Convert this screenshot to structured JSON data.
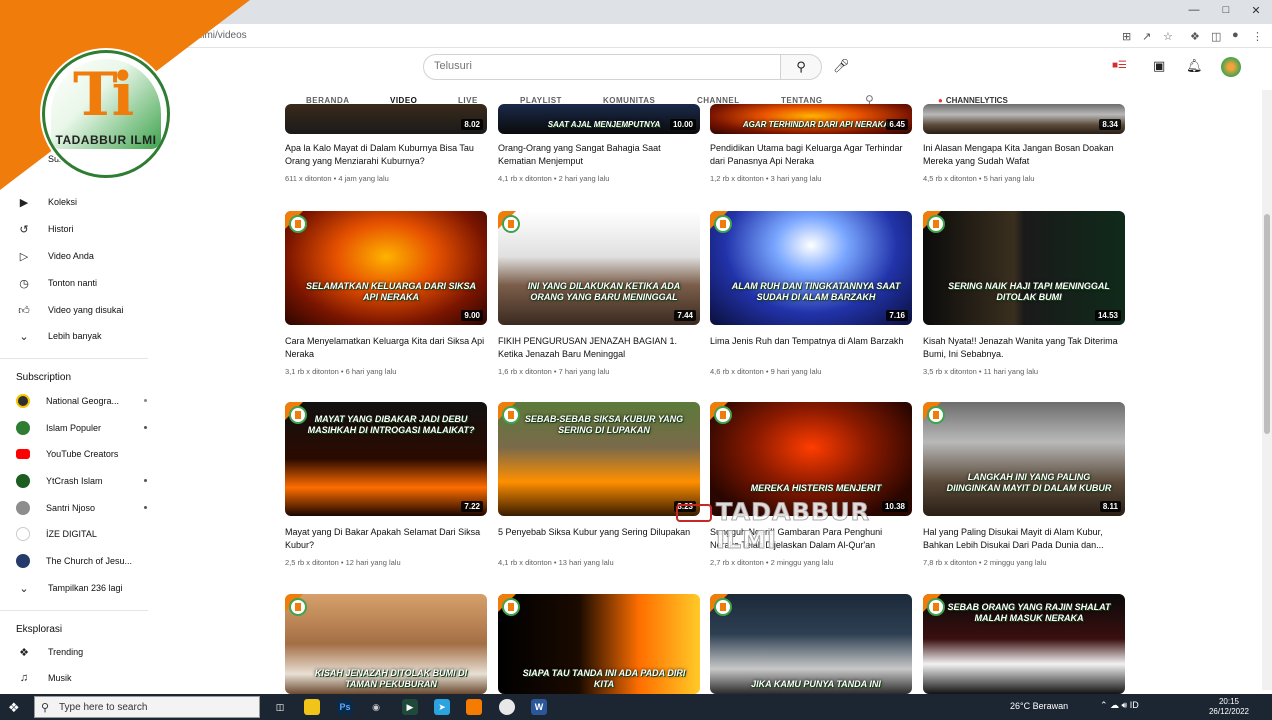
{
  "browser": {
    "url_fragment": "ilmi/videos"
  },
  "channel": {
    "logo_text": "TADABBUR ILMI"
  },
  "header": {
    "search_placeholder": "Telusuri"
  },
  "tabs": [
    {
      "label": "BERANDA"
    },
    {
      "label": "VIDEO"
    },
    {
      "label": "LIVE"
    },
    {
      "label": "PLAYLIST"
    },
    {
      "label": "KOMUNITAS"
    },
    {
      "label": "CHANNEL"
    },
    {
      "label": "TENTANG"
    }
  ],
  "channelytics_label": "CHANNELYTICS",
  "sidebar": {
    "partial_label": "Sub",
    "items": [
      {
        "label": "Koleksi",
        "icon": "library-icon"
      },
      {
        "label": "Histori",
        "icon": "history-icon"
      },
      {
        "label": "Video Anda",
        "icon": "play-icon"
      },
      {
        "label": "Tonton nanti",
        "icon": "clock-icon"
      },
      {
        "label": "Video yang disukai",
        "icon": "thumbs-up-icon"
      },
      {
        "label": "Lebih banyak",
        "icon": "chevron-down-icon"
      }
    ],
    "subscription_heading": "Subscription",
    "subscriptions": [
      {
        "label": "National Geogra...",
        "color": "#2e2e2e"
      },
      {
        "label": "Islam Populer",
        "color": "#2e7d32"
      },
      {
        "label": "YouTube Creators",
        "color": "#ff0000"
      },
      {
        "label": "YtCrash Islam",
        "color": "#1b5e20"
      },
      {
        "label": "Santri Njoso",
        "color": "#8d8d8d"
      },
      {
        "label": "İZE DIGITAL",
        "color": "#ffffff"
      },
      {
        "label": "The Church of Jesu...",
        "color": "#263a6b"
      }
    ],
    "show_more_label": "Tampilkan 236 lagi",
    "explore_heading": "Eksplorasi",
    "explore_items": [
      {
        "label": "Trending",
        "icon": "trending-icon"
      },
      {
        "label": "Musik",
        "icon": "music-icon"
      }
    ]
  },
  "videos": [
    {
      "title": "Apa la Kalo Mayat di Dalam Kuburnya Bisa Tau Orang yang Menziarahi Kuburnya?",
      "views": "611 x ditonton",
      "age": "4 jam yang lalu",
      "duration": "8.02",
      "caption": ""
    },
    {
      "title": "Orang-Orang yang Sangat Bahagia Saat Kematian Menjemput",
      "views": "4,1 rb x ditonton",
      "age": "2 hari yang lalu",
      "duration": "10.00",
      "caption": "SAAT AJAL MENJEMPUTNYA"
    },
    {
      "title": "Pendidikan Utama bagi Keluarga Agar Terhindar dari Panasnya Api Neraka",
      "views": "1,2 rb x ditonton",
      "age": "3 hari yang lalu",
      "duration": "6.45",
      "caption": "AGAR TERHINDAR DARI API NERAKA"
    },
    {
      "title": "Ini Alasan Mengapa Kita Jangan Bosan Doakan Mereka yang Sudah Wafat",
      "views": "4,5 rb x ditonton",
      "age": "5 hari yang lalu",
      "duration": "8.34",
      "caption": ""
    },
    {
      "title": "Cara Menyelamatkan Keluarga Kita dari Siksa Api Neraka",
      "views": "3,1 rb x ditonton",
      "age": "6 hari yang lalu",
      "duration": "9.00",
      "caption": "SELAMATKAN KELUARGA DARI SIKSA API NERAKA"
    },
    {
      "title": "FIKIH PENGURUSAN JENAZAH BAGIAN 1. Ketika Jenazah Baru Meninggal",
      "views": "1,6 rb x ditonton",
      "age": "7 hari yang lalu",
      "duration": "7.44",
      "caption": "INI YANG DILAKUKAN KETIKA ADA ORANG YANG BARU MENINGGAL"
    },
    {
      "title": "Lima Jenis Ruh dan Tempatnya di Alam Barzakh",
      "views": "4,6 rb x ditonton",
      "age": "9 hari yang lalu",
      "duration": "7.16",
      "caption": "ALAM RUH DAN TINGKATANNYA SAAT SUDAH DI ALAM BARZAKH"
    },
    {
      "title": "Kisah Nyata!! Jenazah Wanita yang Tak Diterima Bumi, Ini Sebabnya.",
      "views": "3,5 rb x ditonton",
      "age": "11 hari yang lalu",
      "duration": "14.53",
      "caption": "SERING NAIK HAJI TAPI MENINGGAL DITOLAK BUMI"
    },
    {
      "title": "Mayat yang Di Bakar Apakah Selamat Dari Siksa Kubur?",
      "views": "2,5 rb x ditonton",
      "age": "12 hari yang lalu",
      "duration": "7.22",
      "caption": "MAYAT YANG DIBAKAR JADI DEBU MASIHKAH DI INTROGASI MALAIKAT?"
    },
    {
      "title": "5 Penyebab Siksa Kubur yang Sering Dilupakan",
      "views": "4,1 rb x ditonton",
      "age": "13 hari yang lalu",
      "duration": "8.23",
      "caption": "SEBAB-SEBAB SIKSA KUBUR YANG SERING DI LUPAKAN"
    },
    {
      "title": "Sungguh Ngeri!! Gambaran Para Penghuni Neraka Telah Dijelaskan Dalam Al-Qur'an",
      "views": "2,7 rb x ditonton",
      "age": "2 minggu yang lalu",
      "duration": "10.38",
      "caption": "MEREKA HISTERIS MENJERIT"
    },
    {
      "title": "Hal yang Paling Disukai Mayit di Alam Kubur, Bahkan Lebih Disukai Dari Pada Dunia dan...",
      "views": "7,8 rb x ditonton",
      "age": "2 minggu yang lalu",
      "duration": "8.11",
      "caption": "LANGKAH INI YANG PALING DIINGINKAN MAYIT DI DALAM KUBUR"
    },
    {
      "title": "",
      "views": "",
      "age": "",
      "duration": "",
      "caption": "KISAH JENAZAH DITOLAK BUMI DI TAMAN PEKUBURAN"
    },
    {
      "title": "",
      "views": "",
      "age": "",
      "duration": "",
      "caption": "SIAPA TAU TANDA INI ADA PADA DIRI KITA"
    },
    {
      "title": "",
      "views": "",
      "age": "",
      "duration": "",
      "caption": "JIKA KAMU PUNYA TANDA INI"
    },
    {
      "title": "",
      "views": "",
      "age": "",
      "duration": "",
      "caption": "SEBAB ORANG YANG RAJIN SHALAT MALAH MASUK NERAKA"
    }
  ],
  "watermark_text": "TADABBUR ILMI",
  "taskbar": {
    "search_text": "Type here to search",
    "weather": "26°C  Berawan",
    "time": "20:15",
    "date": "26/12/2022"
  },
  "colors": {
    "brand_orange": "#f07c0c",
    "brand_green": "#3fa34d"
  }
}
